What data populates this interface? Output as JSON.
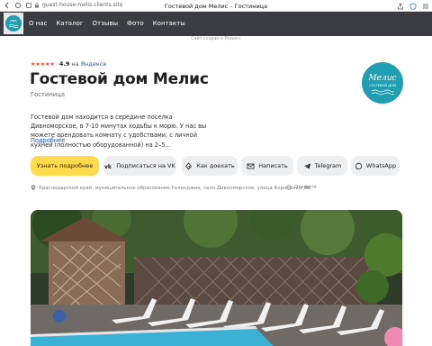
{
  "browser": {
    "url": "guest-house-melis.clients.site",
    "tab_title": "Гостевой дом Мелис – Гостиница"
  },
  "nav": {
    "items": [
      "О нас",
      "Каталог",
      "Отзывы",
      "Фото",
      "Контакты"
    ]
  },
  "made_in": "Сайт создан в Яндекс",
  "rating": {
    "stars": "★★★★★",
    "value": "4.9",
    "on": "на",
    "source": "Яндексе"
  },
  "header": {
    "title": "Гостевой дом Мелис",
    "subtitle": "Гостиница",
    "description": "Гостевой дом находится в середине поселка Дивноморское, в 7-10 минутах ходьбы к морю. У нас вы можете арендовать комнату с удобствами, с личной кухней (полностью оборудованной) на 2–5...",
    "more_link": "Подробнее"
  },
  "brand_logo": {
    "line1": "Мелис",
    "line2": "ГОСТЕВОЙ ДОМ"
  },
  "actions": {
    "learn_more": "Узнать подробнее",
    "vk": "Подписаться на VK",
    "route": "Как доехать",
    "write": "Написать",
    "telegram": "Telegram",
    "whatsapp": "WhatsApp"
  },
  "location": {
    "address": "Краснодарский край, муниципальное образование Геленджик, село Дивноморское, улица Короленко, 6Е",
    "status": "Открыто"
  },
  "colors": {
    "nav_bg": "#3a3c3f",
    "accent_yellow": "#ffdb4d",
    "button_bg": "#eeeff1",
    "link_blue": "#1a56c8",
    "brand_teal": "#1f9fb1",
    "star_red": "#fc3f1d"
  },
  "icons": [
    "back-icon",
    "reload-icon",
    "lock-icon",
    "share-icon",
    "shield-icon",
    "menu-icon",
    "vk-icon",
    "route-icon",
    "mail-icon",
    "telegram-icon",
    "whatsapp-icon",
    "pin-icon",
    "clock-icon"
  ]
}
